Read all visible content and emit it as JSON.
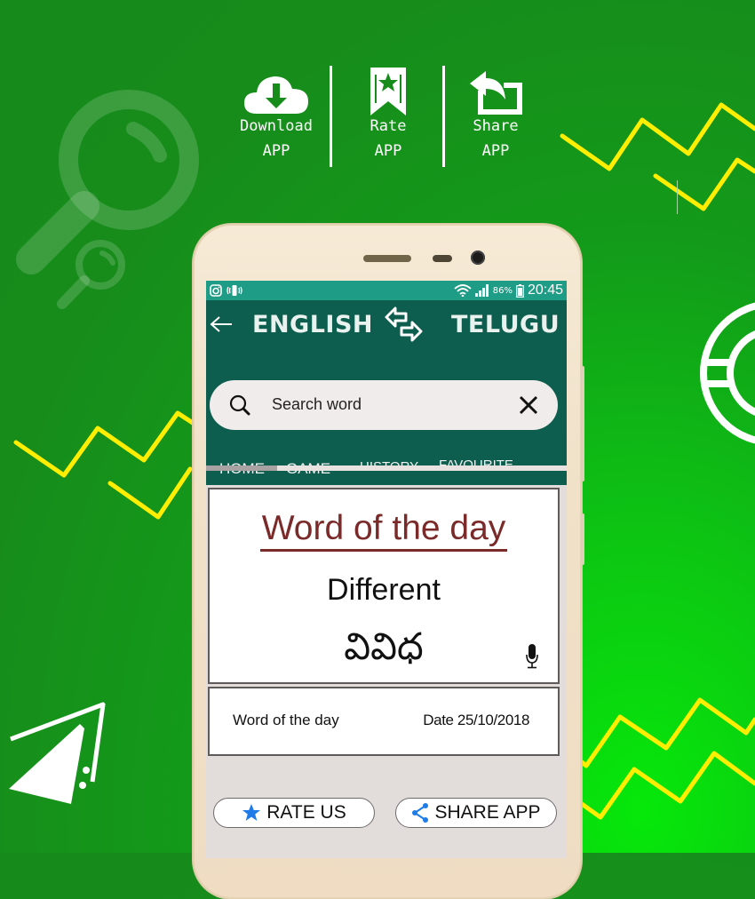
{
  "promo": {
    "items": [
      {
        "line1": "Download",
        "line2": "APP",
        "icon": "cloud-download-icon"
      },
      {
        "line1": "Rate",
        "line2": "APP",
        "icon": "bookmark-star-icon"
      },
      {
        "line1": "Share",
        "line2": "APP",
        "icon": "share-arrow-icon"
      }
    ]
  },
  "status_bar": {
    "left_icons": [
      "instagram-icon",
      "vibrate-icon"
    ],
    "battery": "86%",
    "time": "20:45"
  },
  "app_bar": {
    "source_language": "ENGLISH",
    "target_language": "TELUGU",
    "swap_icon": "swap-arrows-icon",
    "back_icon": "back-arrow-icon"
  },
  "search": {
    "placeholder": "Search word",
    "value": ""
  },
  "tabs": [
    {
      "label": "HOME",
      "active": true
    },
    {
      "label": "GAME",
      "active": false
    },
    {
      "label": "HISTORY",
      "active": false
    },
    {
      "label": "FAVOURITE",
      "active": false
    }
  ],
  "word_of_day": {
    "heading": "Word of the day",
    "english": "Different",
    "telugu": "వివిధ"
  },
  "footer_card": {
    "label": "Word of the day",
    "date": "Date 25/10/2018"
  },
  "buttons": {
    "rate": "RATE US",
    "share": "SHARE APP"
  },
  "colors": {
    "background_green": "#178c1b",
    "accent_yellow": "#ffee00",
    "app_bar": "#0e5e4f",
    "status_bar": "#1f9c85",
    "heading_red": "#7b2a2a",
    "icon_blue": "#1e7be8"
  }
}
